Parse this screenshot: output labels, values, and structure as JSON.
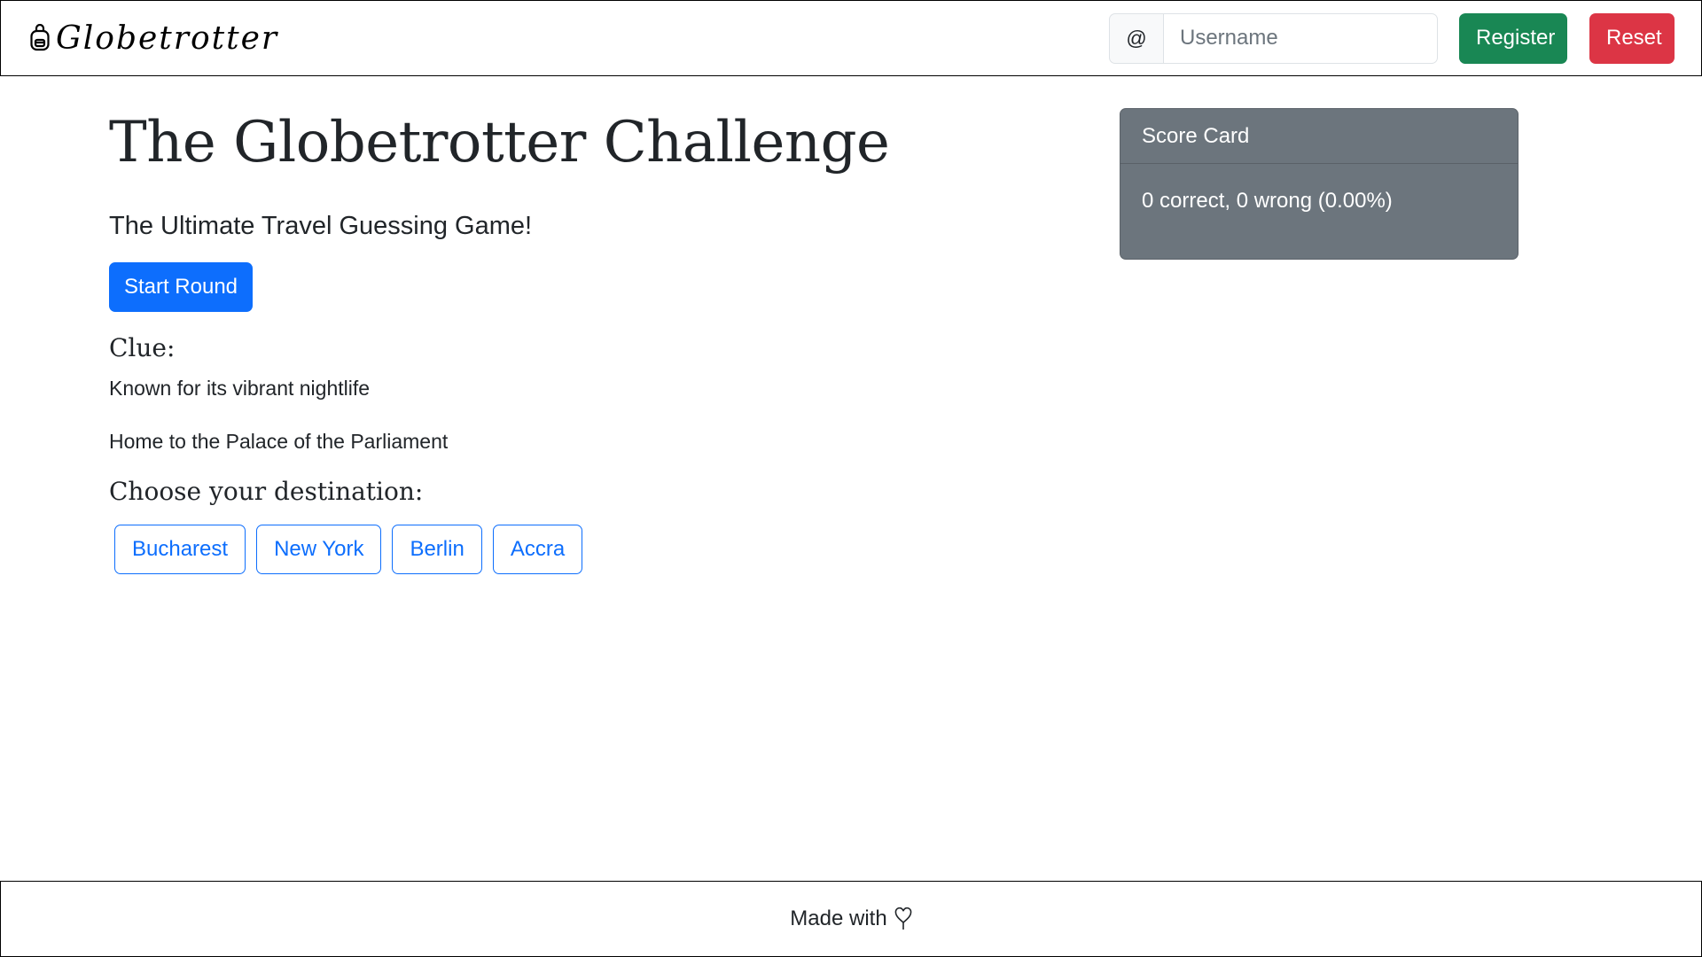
{
  "navbar": {
    "brand_text": "Globetrotter",
    "brand_icon": "backpack-icon",
    "username_prefix": "@",
    "username_placeholder": "Username",
    "username_value": "",
    "register_label": "Register",
    "reset_label": "Reset"
  },
  "main": {
    "title": "The Globetrotter Challenge",
    "subtitle": "The Ultimate Travel Guessing Game!",
    "start_label": "Start Round",
    "clue_heading": "Clue:",
    "clues": [
      "Known for its vibrant nightlife",
      "Home to the Palace of the Parliament"
    ],
    "choose_heading": "Choose your destination:",
    "choices": [
      "Bucharest",
      "New York",
      "Berlin",
      "Accra"
    ]
  },
  "score_card": {
    "header": "Score Card",
    "summary": "0 correct, 0 wrong (0.00%)"
  },
  "footer": {
    "text": "Made with",
    "icon": "heart-icon"
  },
  "colors": {
    "primary": "#0d6efd",
    "success": "#198754",
    "danger": "#dc3545",
    "secondary": "#6c757d"
  }
}
